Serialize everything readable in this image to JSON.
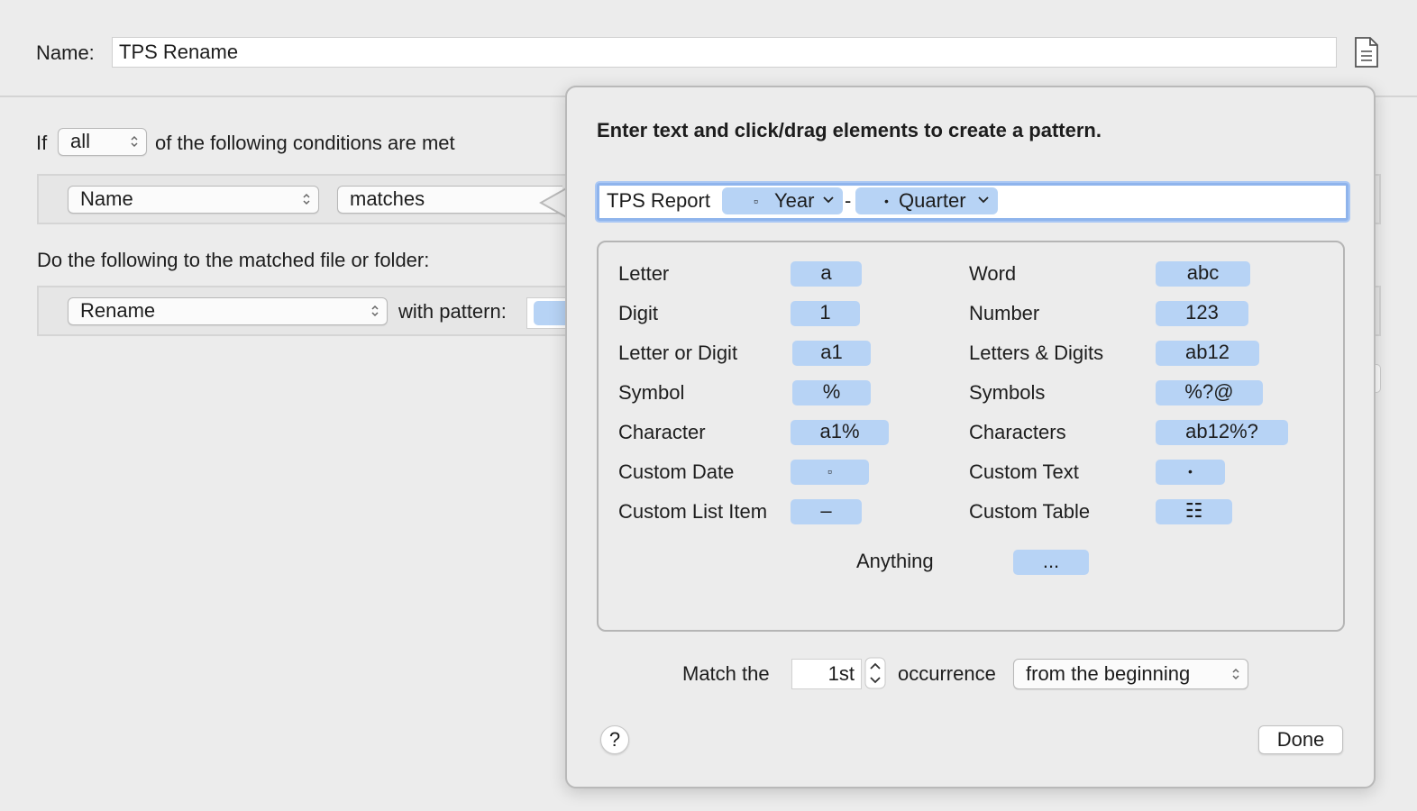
{
  "rule": {
    "name_label": "Name:",
    "name_value": "TPS Rename"
  },
  "conditions": {
    "if_label": "If",
    "match_mode": "all",
    "suffix": "of the following conditions are met",
    "attribute": "Name",
    "operator": "matches"
  },
  "actions": {
    "heading": "Do the following to the matched file or folder:",
    "action": "Rename",
    "with_pattern_label": "with pattern:"
  },
  "popover": {
    "title": "Enter text and click/drag elements to create a pattern.",
    "pattern": {
      "text_prefix": "TPS Report",
      "token1_glyph": "▫",
      "token1_label": "Year",
      "separator": "-",
      "token2_glyph": "•",
      "token2_label": "Quarter"
    },
    "elements": [
      {
        "label": "Letter",
        "chip": "a"
      },
      {
        "label": "Word",
        "chip": "abc"
      },
      {
        "label": "Digit",
        "chip": "1"
      },
      {
        "label": "Number",
        "chip": "123"
      },
      {
        "label": "Letter or Digit",
        "chip": "a1"
      },
      {
        "label": "Letters & Digits",
        "chip": "ab12"
      },
      {
        "label": "Symbol",
        "chip": "%"
      },
      {
        "label": "Symbols",
        "chip": "%?@"
      },
      {
        "label": "Character",
        "chip": "a1%"
      },
      {
        "label": "Characters",
        "chip": "ab12%?"
      },
      {
        "label": "Custom Date",
        "chip": "▫"
      },
      {
        "label": "Custom Text",
        "chip": "•"
      },
      {
        "label": "Custom List Item",
        "chip": "–"
      },
      {
        "label": "Custom Table",
        "chip": "☷"
      },
      {
        "label": "Anything",
        "chip": "..."
      }
    ],
    "match_the_label": "Match the",
    "occurrence_value": "1st",
    "occurrence_label": "occurrence",
    "direction": "from the beginning",
    "help_label": "?",
    "done_label": "Done"
  },
  "colors": {
    "token_blue": "#b7d3f5",
    "focus_ring": "#8fb4ec",
    "window_bg": "#ececec"
  }
}
